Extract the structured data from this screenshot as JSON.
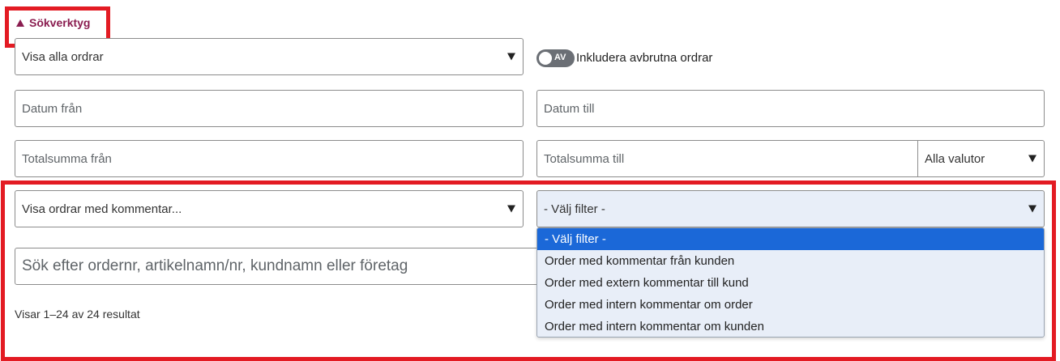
{
  "search_tools": {
    "toggle_label": "Sökverktyg"
  },
  "order_filter": {
    "value": "Visa alla ordrar"
  },
  "cancelled_toggle": {
    "state_label": "AV",
    "label": "Inkludera avbrutna ordrar"
  },
  "date_from": {
    "placeholder": "Datum från"
  },
  "date_to": {
    "placeholder": "Datum till"
  },
  "total_from": {
    "placeholder": "Totalsumma från"
  },
  "total_to": {
    "placeholder": "Totalsumma till"
  },
  "currency": {
    "value": "Alla valutor"
  },
  "comment_filter": {
    "value": "Visa ordrar med kommentar..."
  },
  "filter_select": {
    "value": "- Välj filter -",
    "options": [
      "- Välj filter -",
      "Order med kommentar från kunden",
      "Order med extern kommentar till kund",
      "Order med intern kommentar om order",
      "Order med intern kommentar om kunden"
    ],
    "selected_index": 0
  },
  "search": {
    "placeholder": "Sök efter ordernr, artikelnamn/nr, kundnamn eller företag"
  },
  "results": {
    "text": "Visar 1–24 av 24 resultat"
  },
  "colors": {
    "accent": "#8a1d50",
    "highlight_box": "#e31b23",
    "option_selected": "#1b68d8",
    "dropdown_bg": "#e8eef8"
  }
}
